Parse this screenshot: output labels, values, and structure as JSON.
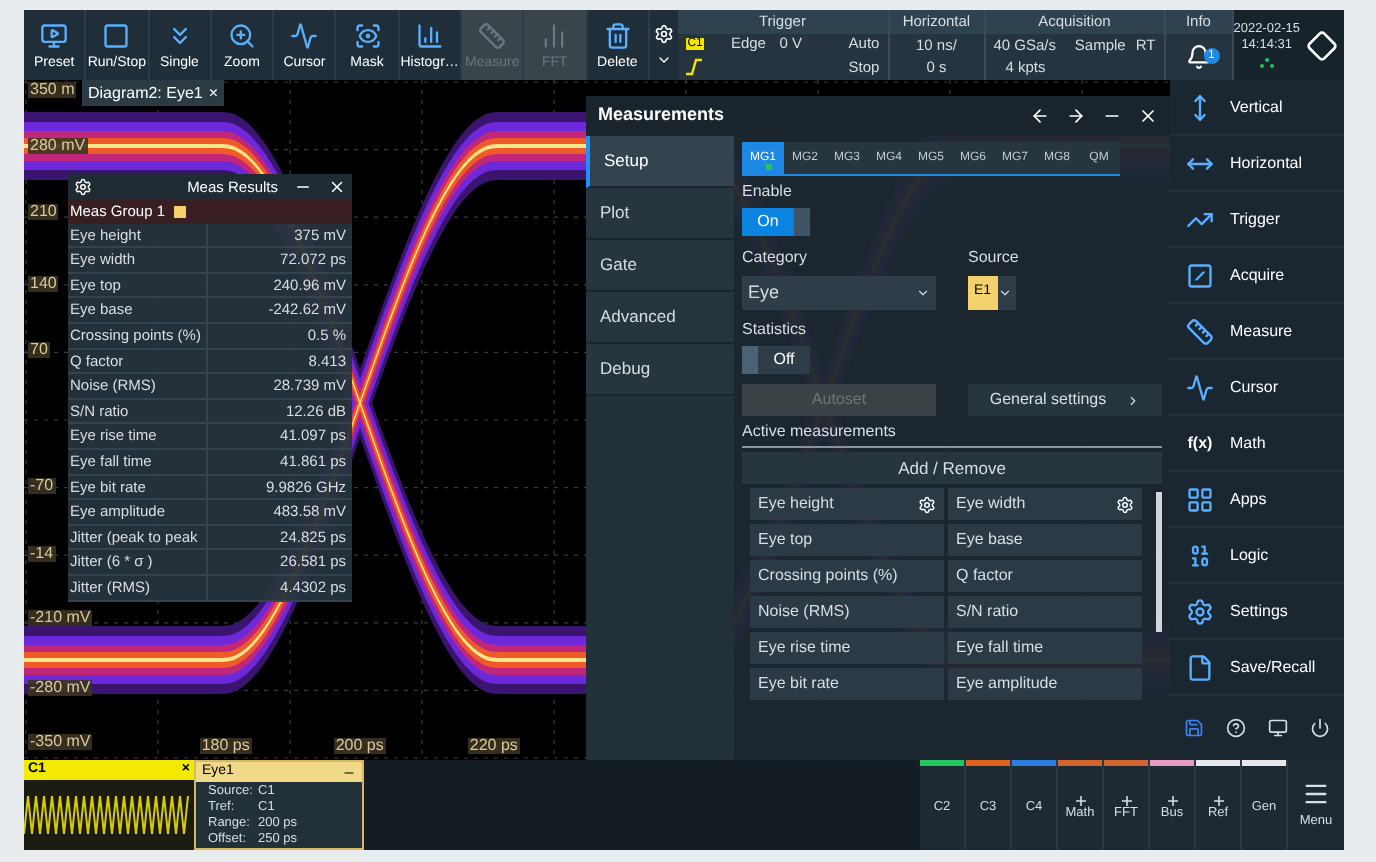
{
  "toolbar": {
    "buttons": [
      {
        "label": "Preset",
        "kind": "preset",
        "disabled": false
      },
      {
        "label": "Run/Stop",
        "kind": "stop",
        "disabled": false
      },
      {
        "label": "Single",
        "kind": "single",
        "disabled": false
      },
      {
        "label": "Zoom",
        "kind": "zoom",
        "disabled": false
      },
      {
        "label": "Cursor",
        "kind": "cursor",
        "disabled": false
      },
      {
        "label": "Mask",
        "kind": "mask",
        "disabled": false
      },
      {
        "label": "Histogr…",
        "kind": "histogram",
        "disabled": false
      },
      {
        "label": "Measure",
        "kind": "measure",
        "disabled": true
      },
      {
        "label": "FFT",
        "kind": "fft",
        "disabled": true
      },
      {
        "label": "Delete",
        "kind": "delete",
        "disabled": false
      }
    ]
  },
  "status": {
    "trigger": {
      "title": "Trigger",
      "source": "C1",
      "type": "Edge",
      "level": "0 V",
      "mode": "Auto",
      "state": "Stop"
    },
    "horizontal": {
      "title": "Horizontal",
      "scale": "10 ns/",
      "position": "0 s"
    },
    "acquisition": {
      "title": "Acquisition",
      "rate": "40 GSa/s",
      "mode": "Sample",
      "type": "RT",
      "length": "4 kpts"
    },
    "info": {
      "title": "Info",
      "count": "1"
    },
    "date": "2022-02-15",
    "time": "14:14:31"
  },
  "diagram": {
    "tab": "Diagram2: Eye1",
    "close": "×",
    "y_labels": [
      "350 m",
      "280 mV",
      "210",
      "140",
      "70",
      "-70",
      "-14",
      "-210 mV",
      "-280 mV",
      "-350 mV"
    ],
    "x_labels": [
      "180 ps",
      "200 ps",
      "220 ps"
    ]
  },
  "meas_results": {
    "title": "Meas Results",
    "group": "Meas Group 1",
    "rows": [
      {
        "name": "Eye height",
        "value": "375 mV"
      },
      {
        "name": "Eye width",
        "value": "72.072 ps"
      },
      {
        "name": "Eye top",
        "value": "240.96 mV"
      },
      {
        "name": "Eye base",
        "value": "-242.62 mV"
      },
      {
        "name": "Crossing points (%)",
        "value": "0.5 %"
      },
      {
        "name": "Q factor",
        "value": "8.413"
      },
      {
        "name": "Noise (RMS)",
        "value": "28.739 mV"
      },
      {
        "name": "S/N ratio",
        "value": "12.26 dB"
      },
      {
        "name": "Eye rise time",
        "value": "41.097 ps"
      },
      {
        "name": "Eye fall time",
        "value": "41.861 ps"
      },
      {
        "name": "Eye bit rate",
        "value": "9.9826 GHz"
      },
      {
        "name": "Eye amplitude",
        "value": "483.58 mV"
      },
      {
        "name": "Jitter (peak to peak",
        "value": "24.825 ps"
      },
      {
        "name": "Jitter (6 * σ )",
        "value": "26.581 ps"
      },
      {
        "name": "Jitter (RMS)",
        "value": "4.4302 ps"
      }
    ]
  },
  "measurements_dialog": {
    "title": "Measurements",
    "nav": [
      {
        "label": "Setup",
        "selected": true
      },
      {
        "label": "Plot",
        "selected": false
      },
      {
        "label": "Gate",
        "selected": false
      },
      {
        "label": "Advanced",
        "selected": false
      },
      {
        "label": "Debug",
        "selected": false
      }
    ],
    "tabs": [
      {
        "label": "MG1",
        "selected": true,
        "active": true
      },
      {
        "label": "MG2",
        "selected": false,
        "active": false
      },
      {
        "label": "MG3",
        "selected": false,
        "active": false
      },
      {
        "label": "MG4",
        "selected": false,
        "active": false
      },
      {
        "label": "MG5",
        "selected": false,
        "active": false
      },
      {
        "label": "MG6",
        "selected": false,
        "active": false
      },
      {
        "label": "MG7",
        "selected": false,
        "active": false
      },
      {
        "label": "MG8",
        "selected": false,
        "active": false
      },
      {
        "label": "QM",
        "selected": false,
        "active": false
      }
    ],
    "enable": {
      "label": "Enable",
      "on": true,
      "text": "On"
    },
    "category": {
      "label": "Category",
      "value": "Eye"
    },
    "source": {
      "label": "Source",
      "value": "E1"
    },
    "statistics": {
      "label": "Statistics",
      "on": false,
      "text": "Off"
    },
    "autoset": {
      "label": "Autoset",
      "disabled": true
    },
    "general_settings": "General settings",
    "active_heading": "Active measurements",
    "add_remove": "Add / Remove",
    "items": [
      {
        "label": "Eye height",
        "settings": true
      },
      {
        "label": "Eye width",
        "settings": true
      },
      {
        "label": "Eye top",
        "settings": false
      },
      {
        "label": "Eye base",
        "settings": false
      },
      {
        "label": "Crossing points (%)",
        "settings": false
      },
      {
        "label": "Q factor",
        "settings": false
      },
      {
        "label": "Noise (RMS)",
        "settings": false
      },
      {
        "label": "S/N ratio",
        "settings": false
      },
      {
        "label": "Eye rise time",
        "settings": false
      },
      {
        "label": "Eye fall time",
        "settings": false
      },
      {
        "label": "Eye bit rate",
        "settings": false
      },
      {
        "label": "Eye amplitude",
        "settings": false
      }
    ]
  },
  "side_menu": {
    "items": [
      {
        "label": "Vertical",
        "kind": "vertical"
      },
      {
        "label": "Horizontal",
        "kind": "horizontal"
      },
      {
        "label": "Trigger",
        "kind": "trigger"
      },
      {
        "label": "Acquire",
        "kind": "acquire"
      },
      {
        "label": "Measure",
        "kind": "measure"
      },
      {
        "label": "Cursor",
        "kind": "cursor"
      },
      {
        "label": "Math",
        "kind": "math",
        "glyph": "f(x)"
      },
      {
        "label": "Apps",
        "kind": "apps"
      },
      {
        "label": "Logic",
        "kind": "logic"
      },
      {
        "label": "Settings",
        "kind": "settings"
      },
      {
        "label": "Save/Recall",
        "kind": "save"
      }
    ]
  },
  "bottom": {
    "c1": {
      "label": "C1",
      "close": "×"
    },
    "eye": {
      "title": "Eye1",
      "lines": [
        {
          "label": "Source:",
          "value": "C1"
        },
        {
          "label": "Tref:",
          "value": "C1"
        },
        {
          "label": "Range:",
          "value": "200 ps"
        },
        {
          "label": "Offset:",
          "value": "250 ps"
        }
      ]
    },
    "channels": [
      {
        "label": "C2",
        "plus": false,
        "color": "#22c55e"
      },
      {
        "label": "C3",
        "plus": false,
        "color": "#e0601f"
      },
      {
        "label": "C4",
        "plus": false,
        "color": "#2b7de0"
      },
      {
        "label": "Math",
        "plus": true,
        "color": "#d0652e"
      },
      {
        "label": "FFT",
        "plus": true,
        "color": "#d0652e"
      },
      {
        "label": "Bus",
        "plus": true,
        "color": "#e79ac0"
      },
      {
        "label": "Ref",
        "plus": true,
        "color": "#e5e7eb"
      },
      {
        "label": "Gen",
        "plus": false,
        "color": "#e5e7eb"
      }
    ],
    "menu": "Menu"
  }
}
